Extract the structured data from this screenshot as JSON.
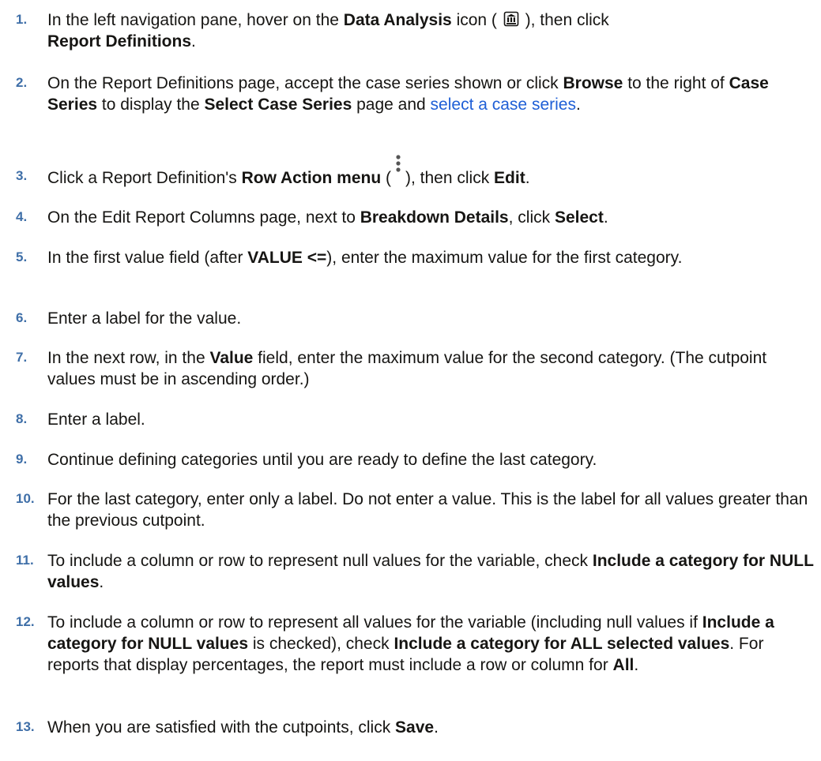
{
  "icons": {
    "data_analysis": "data-analysis-icon",
    "row_action": "kebab-menu-icon"
  },
  "colors": {
    "step_number": "#3f6fa8",
    "link": "#1f5fd6",
    "text": "#161513"
  },
  "steps": [
    {
      "num": "1.",
      "t1": "In the left navigation pane, hover on the ",
      "b1": "Data Analysis",
      "t2": " icon ( ",
      "t3": " ), then click ",
      "b2": "Report Definitions",
      "t4": "."
    },
    {
      "num": "2.",
      "t1": "On the Report Definitions page, accept the case series shown or click ",
      "b1": "Browse",
      "t2": " to the right of ",
      "b2": "Case Series",
      "t3": " to display the ",
      "b3": "Select Case Series",
      "t4": " page and ",
      "link": "select a case series",
      "t5": "."
    },
    {
      "num": "3.",
      "t1": "Click a Report Definition's ",
      "b1": "Row Action menu",
      "t2": " (",
      "t3": "), then click ",
      "b2": "Edit",
      "t4": "."
    },
    {
      "num": "4.",
      "t1": "On the Edit Report Columns page, next to ",
      "b1": "Breakdown Details",
      "t2": ", click ",
      "b2": "Select",
      "t3": "."
    },
    {
      "num": "5.",
      "t1": "In the first value field (after ",
      "b1": "VALUE <=",
      "t2": "), enter the maximum value for the first category."
    },
    {
      "num": "6.",
      "t1": "Enter a label for the value."
    },
    {
      "num": "7.",
      "t1": "In the next row, in the ",
      "b1": "Value",
      "t2": " field, enter the maximum value for the second category. (The cutpoint values must be in ascending order.)"
    },
    {
      "num": "8.",
      "t1": "Enter a label."
    },
    {
      "num": "9.",
      "t1": "Continue defining categories until you are ready to define the last category."
    },
    {
      "num": "10.",
      "t1": "For the last category, enter only a label. Do not enter a value. This is the label for all values greater than the previous cutpoint."
    },
    {
      "num": "11.",
      "t1": "To include a column or row to represent null values for the variable, check ",
      "b1": "Include a category for NULL values",
      "t2": "."
    },
    {
      "num": "12.",
      "t1": "To include a column or row to represent all values for the variable (including null values if ",
      "b1": "Include a category for NULL values",
      "t2": " is checked), check ",
      "b2": "Include a category for ALL selected values",
      "t3": ". For reports that display percentages, the report must include a row or column for ",
      "b3": "All",
      "t4": "."
    },
    {
      "num": "13.",
      "t1": "When you are satisfied with the cutpoints, click ",
      "b1": "Save",
      "t2": "."
    }
  ]
}
